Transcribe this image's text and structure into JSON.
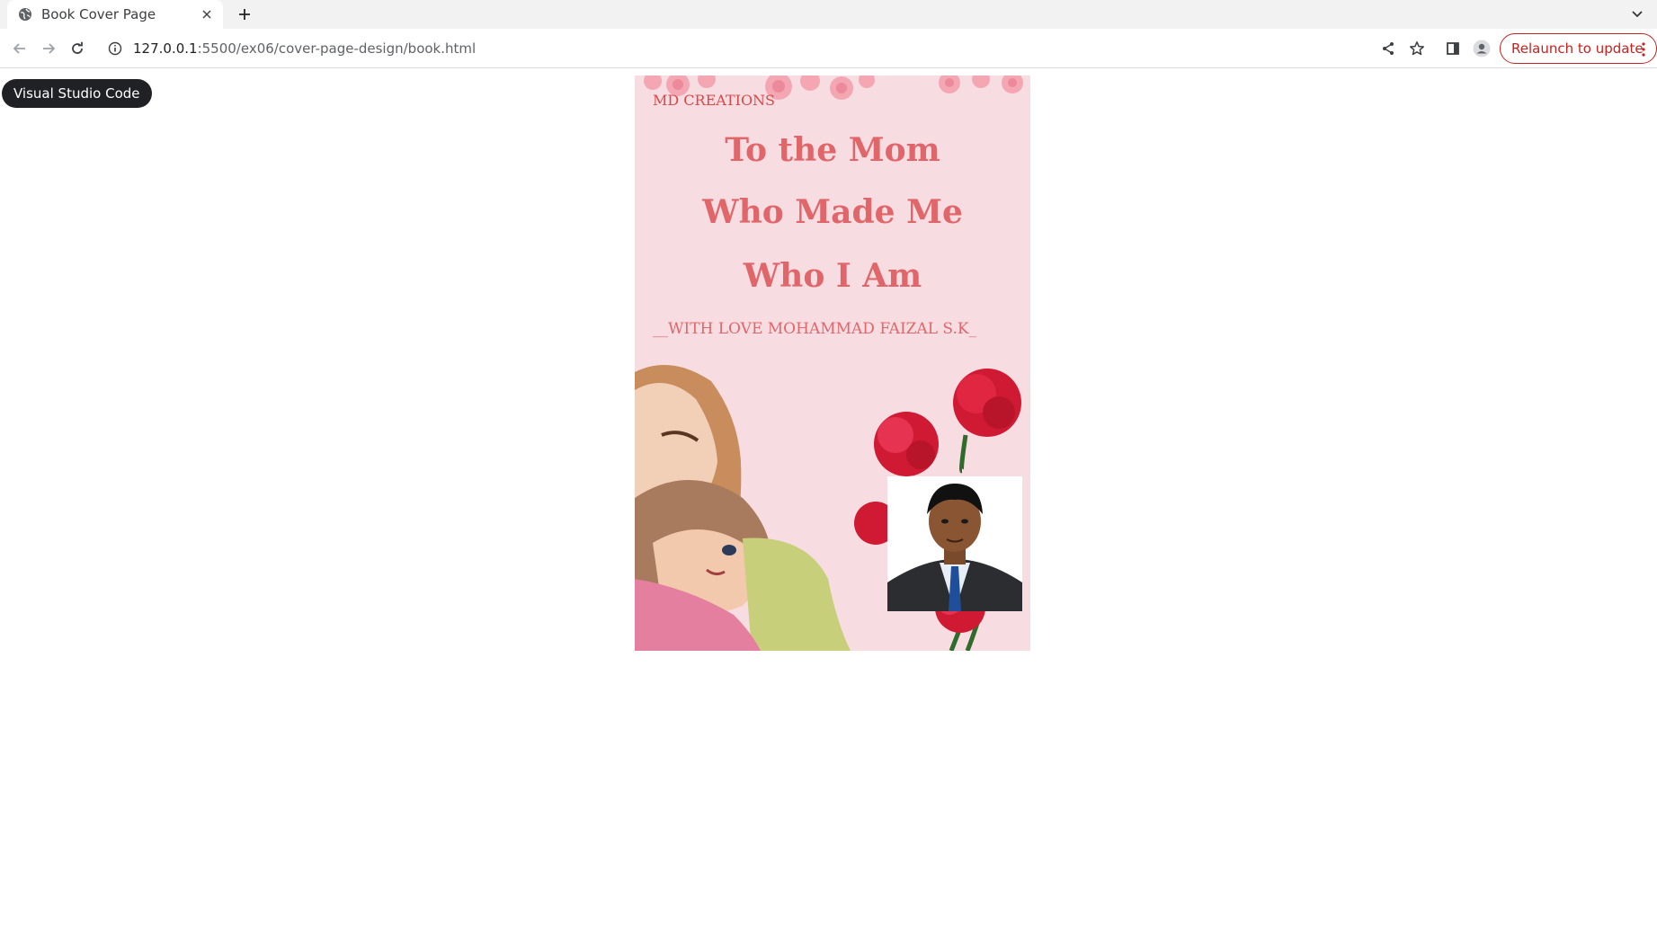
{
  "browser": {
    "tab": {
      "title": "Book Cover Page",
      "favicon": "globe-icon"
    },
    "url": {
      "host": "127.0.0.1",
      "path": ":5500/ex06/cover-page-design/book.html"
    },
    "relaunch_label": "Relaunch to update",
    "accent": "#c5221f"
  },
  "page": {
    "tooltip_badge": "Visual Studio Code",
    "cover": {
      "publisher": "MD CREATIONS",
      "title_lines": [
        "To the Mom",
        "Who Made Me",
        "Who I Am"
      ],
      "author_line": "__WITH LOVE MOHAMMAD FAIZAL S.K_",
      "background_color": "#f7dde2",
      "title_color": "#e0666a",
      "illustration": "mother-hugging-child-with-carnations",
      "photo": "author-portrait-photo"
    }
  }
}
